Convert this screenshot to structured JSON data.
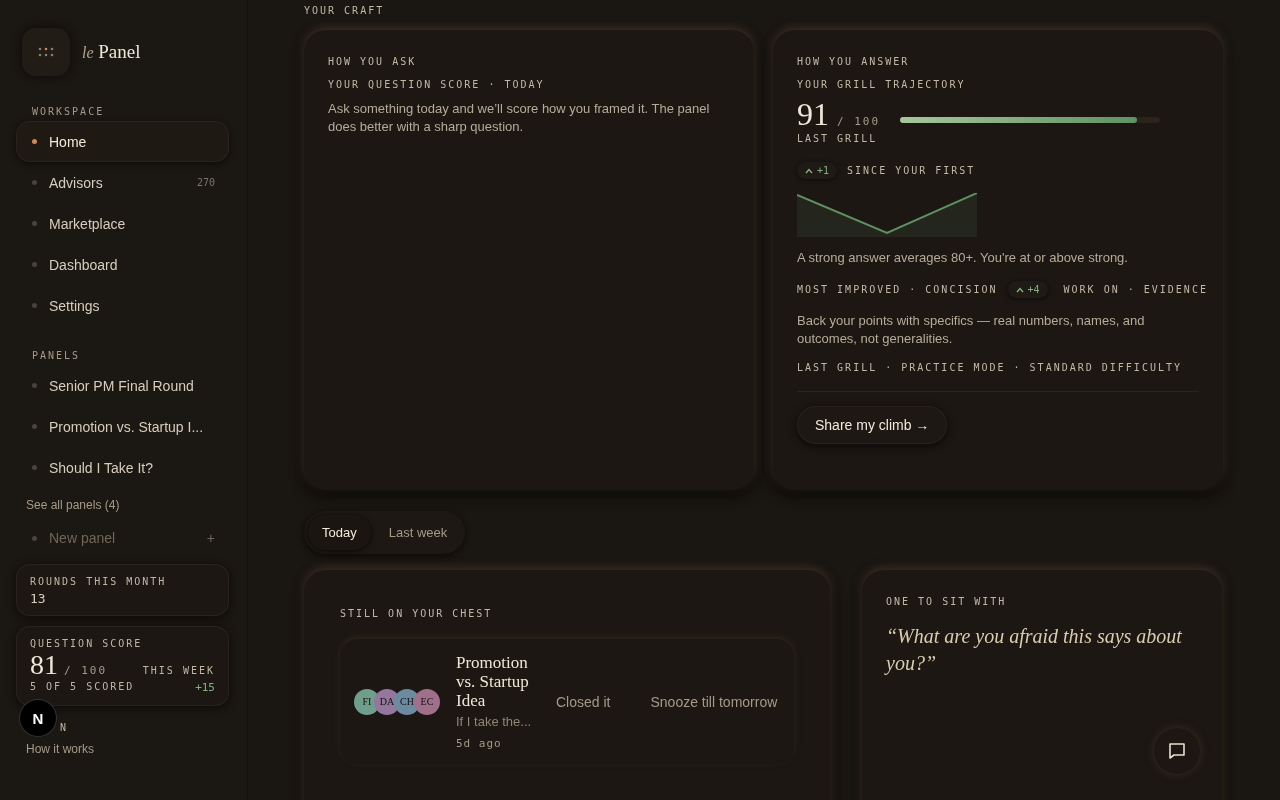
{
  "sidebar": {
    "logo": {
      "prefix": "le",
      "name": "Panel"
    },
    "workspace": {
      "label": "WORKSPACE",
      "items": [
        {
          "label": "Home",
          "selected": true
        },
        {
          "label": "Advisors",
          "selected": false,
          "count": "270"
        },
        {
          "label": "Marketplace",
          "selected": false
        },
        {
          "label": "Dashboard",
          "selected": false
        },
        {
          "label": "Settings",
          "selected": false
        }
      ]
    },
    "panels": {
      "label": "PANELS",
      "items": [
        {
          "label": "Senior PM Final Round",
          "selected": false
        },
        {
          "label": "Promotion vs. Startup I...",
          "selected": false
        },
        {
          "label": "Should I Take It?",
          "selected": false
        }
      ],
      "see_all": "See all panels (4)",
      "new_panel": "New panel",
      "new_icon": "+"
    },
    "rounds": {
      "label": "ROUNDS THIS MONTH",
      "value": "13"
    },
    "question_score": {
      "label": "QUESTION SCORE",
      "value": "81",
      "out_of": "/ 100",
      "period": "THIS WEEK",
      "scored": "5 OF 5 SCORED",
      "delta": "+15"
    },
    "learn": {
      "label": "N",
      "link": "How it works"
    },
    "dev_badge": "N"
  },
  "main": {
    "section_label": "YOUR CRAFT",
    "ask_card": {
      "eyebrow": "HOW YOU ASK",
      "title": "YOUR QUESTION SCORE · TODAY",
      "body": "Ask something today and we’ll score how you framed it. The panel does better with a sharp question."
    },
    "answer_card": {
      "eyebrow": "HOW YOU ANSWER",
      "title": "YOUR GRILL TRAJECTORY",
      "score": "91",
      "out_of": "/ 100",
      "level": 0.91,
      "score_label": "LAST GRILL",
      "since": {
        "delta": "+1",
        "label": "SINCE YOUR FIRST"
      },
      "body": "A strong answer averages 80+. You're at or above strong.",
      "improved": {
        "label": "MOST IMPROVED · CONCISION",
        "delta": "+4"
      },
      "work_on": "WORK ON · EVIDENCE",
      "advice": "Back your points with specifics — real numbers, names, and outcomes, not generalities.",
      "meta": "LAST GRILL · PRACTICE MODE · STANDARD DIFFICULTY",
      "share_button": "Share my climb →"
    },
    "tabs": [
      {
        "label": "Today",
        "selected": true
      },
      {
        "label": "Last week",
        "selected": false
      }
    ],
    "chest_card": {
      "title": "STILL ON YOUR CHEST",
      "items": [
        {
          "avatars": [
            {
              "initials": "FI",
              "color": "#6f9e8c"
            },
            {
              "initials": "DA",
              "color": "#94769f"
            },
            {
              "initials": "CH",
              "color": "#6c8aa0"
            },
            {
              "initials": "EC",
              "color": "#a06f8c"
            }
          ],
          "title": "Promotion vs. Startup Idea",
          "excerpt": "If I take the...",
          "age": "5d ago",
          "actions": [
            "Closed it",
            "Snooze till tomorrow"
          ]
        }
      ]
    },
    "quote_card": {
      "eyebrow": "ONE TO SIT WITH",
      "quote": "“What are you afraid this says about you?”"
    }
  }
}
